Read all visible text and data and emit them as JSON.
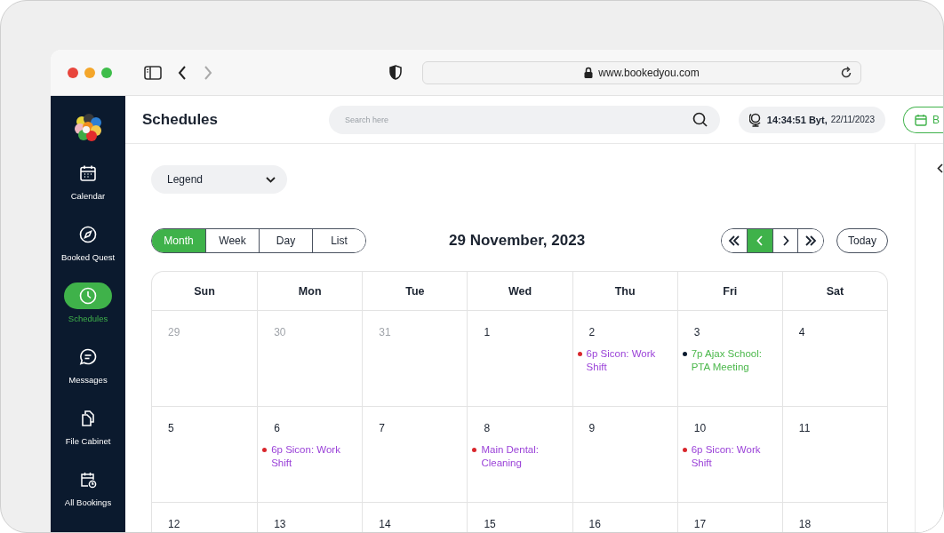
{
  "browser": {
    "url": "www.bookedyou.com"
  },
  "sidebar": {
    "items": [
      {
        "label": "Calendar",
        "selected": false
      },
      {
        "label": "Booked Quest",
        "selected": false
      },
      {
        "label": "Schedules",
        "selected": true
      },
      {
        "label": "Messages",
        "selected": false
      },
      {
        "label": "File Cabinet",
        "selected": false
      },
      {
        "label": "All Bookings",
        "selected": false
      }
    ]
  },
  "header": {
    "title": "Schedules",
    "search": {
      "placeholder": "Search here"
    },
    "time": "14:34:51 Byt,",
    "date": "22/11/2023",
    "button": "B"
  },
  "legend": {
    "label": "Legend"
  },
  "views": [
    {
      "label": "Month",
      "selected": true
    },
    {
      "label": "Week",
      "selected": false
    },
    {
      "label": "Day",
      "selected": false
    },
    {
      "label": "List",
      "selected": false
    }
  ],
  "calendar": {
    "title": "29 November, 2023",
    "nav": [
      {
        "kind": "first",
        "selected": false
      },
      {
        "kind": "prev",
        "selected": true
      },
      {
        "kind": "next",
        "selected": false
      },
      {
        "kind": "last",
        "selected": false
      }
    ],
    "today": "Today",
    "weekdays": [
      "Sun",
      "Mon",
      "Tue",
      "Wed",
      "Thu",
      "Fri",
      "Sat"
    ],
    "weeks": [
      [
        {
          "day": "29",
          "outside": true
        },
        {
          "day": "30",
          "outside": true
        },
        {
          "day": "31",
          "outside": true
        },
        {
          "day": "1",
          "outside": false
        },
        {
          "day": "2",
          "outside": false,
          "events": [
            {
              "text": "6p Sicon: Work Shift",
              "kind": "work",
              "color": "#9b43d8"
            }
          ]
        },
        {
          "day": "3",
          "outside": false,
          "events": [
            {
              "text": "7p Ajax School: PTA Meeting",
              "kind": "school",
              "color": "#4cb84c"
            }
          ]
        },
        {
          "day": "4",
          "outside": false
        }
      ],
      [
        {
          "day": "5",
          "outside": false
        },
        {
          "day": "6",
          "outside": false,
          "events": [
            {
              "text": "6p Sicon: Work Shift",
              "kind": "work",
              "color": "#9b43d8"
            }
          ]
        },
        {
          "day": "7",
          "outside": false
        },
        {
          "day": "8",
          "outside": false,
          "events": [
            {
              "text": "Main Dental: Cleaning",
              "kind": "work",
              "color": "#9b43d8"
            }
          ]
        },
        {
          "day": "9",
          "outside": false
        },
        {
          "day": "10",
          "outside": false,
          "events": [
            {
              "text": "6p Sicon: Work Shift",
              "kind": "work",
              "color": "#9b43d8"
            }
          ]
        },
        {
          "day": "11",
          "outside": false
        }
      ],
      [
        {
          "day": "12",
          "outside": false
        },
        {
          "day": "13",
          "outside": false
        },
        {
          "day": "14",
          "outside": false
        },
        {
          "day": "15",
          "outside": false
        },
        {
          "day": "16",
          "outside": false
        },
        {
          "day": "17",
          "outside": false
        },
        {
          "day": "18",
          "outside": false
        }
      ]
    ]
  }
}
